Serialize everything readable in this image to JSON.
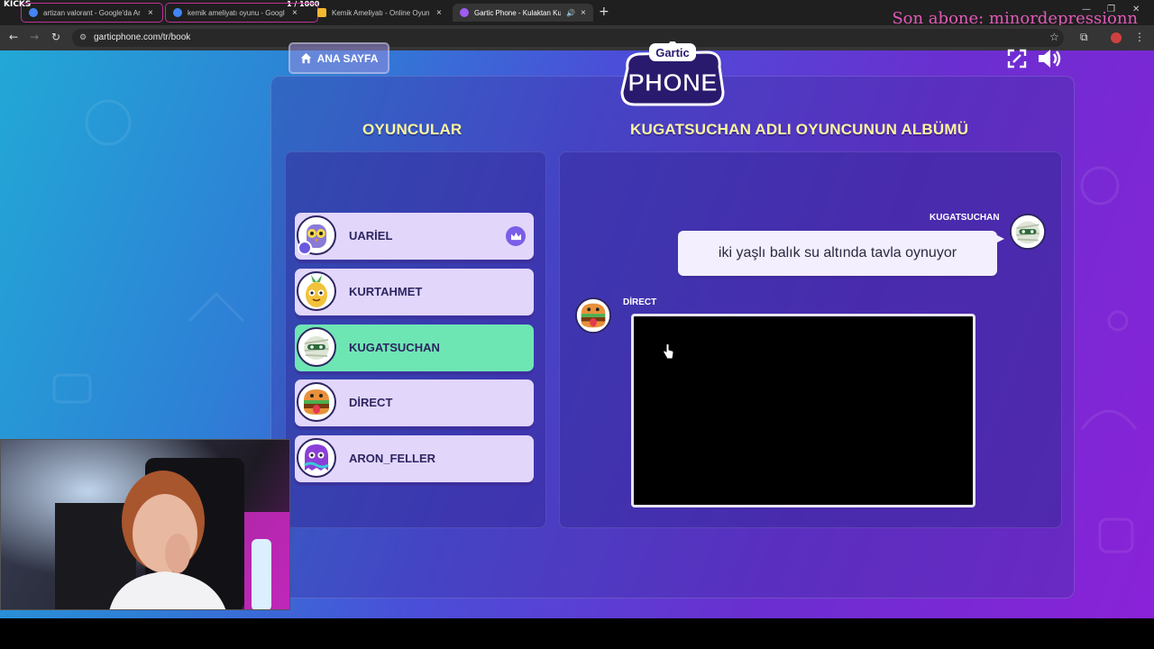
{
  "overlay": {
    "channel_label": "KICKS",
    "tab_counter": "1 / 1000",
    "last_subscriber": "Son abone: minordepressionn"
  },
  "browser": {
    "tabs": [
      {
        "title": "artizan valorant - Google'da Ar",
        "favicon_color": "#4285f4"
      },
      {
        "title": "kemik ameliyatı oyunu - Googl",
        "favicon_color": "#4285f4"
      },
      {
        "title": "Kemik Ameliyatı - Online Oyun",
        "favicon_color": "#f2b82e"
      },
      {
        "title": "Gartic Phone - Kulaktan Ku",
        "favicon_color": "#a05cf0"
      }
    ],
    "url": "garticphone.com/tr/book"
  },
  "game": {
    "home_button": "ANA SAYFA",
    "logo_top": "Gartic",
    "logo_bottom": "PHONE",
    "players_heading": "OYUNCULAR",
    "album_heading": "KUGATSUCHAN ADLI OYUNCUNUN ALBÜMÜ",
    "players": [
      {
        "name": "UARİEL",
        "avatar": "owl-avatar",
        "color": "#8a7ad8"
      },
      {
        "name": "KURTAHMET",
        "avatar": "pineapple-avatar",
        "color": "#f2c23a"
      },
      {
        "name": "KUGATSUCHAN",
        "avatar": "mummy-avatar",
        "color": "#dfe6d8"
      },
      {
        "name": "DİRECT",
        "avatar": "burger-avatar",
        "color": "#e8913a"
      },
      {
        "name": "ARON_FELLER",
        "avatar": "ghost-avatar",
        "color": "#8b3fd8"
      }
    ],
    "album": {
      "message_author": "KUGATSUCHAN",
      "message_text": "iki yaşlı balık su altında tavla oynuyor",
      "drawing_author": "DİRECT"
    }
  }
}
